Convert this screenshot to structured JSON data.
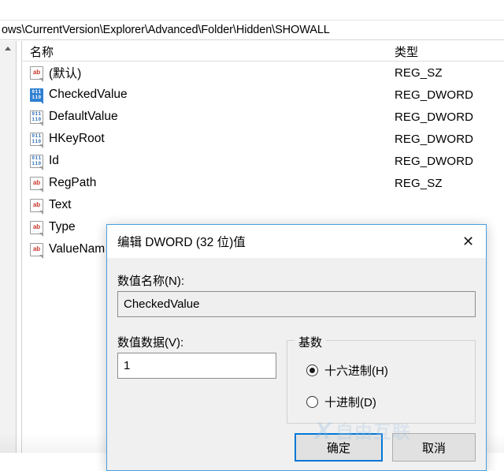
{
  "window": {
    "path_bar_value": "ows\\CurrentVersion\\Explorer\\Advanced\\Folder\\Hidden\\SHOWALL"
  },
  "tree_pane": {
    "scroll_up_icon": "chevron-up-icon"
  },
  "list_view": {
    "columns": [
      "名称",
      "类型"
    ],
    "rows": [
      {
        "name": "(默认)",
        "type": "REG_SZ",
        "icon": "string-value-icon",
        "selected": false
      },
      {
        "name": "CheckedValue",
        "type": "REG_DWORD",
        "icon": "dword-value-icon",
        "selected": true
      },
      {
        "name": "DefaultValue",
        "type": "REG_DWORD",
        "icon": "dword-value-icon",
        "selected": false
      },
      {
        "name": "HKeyRoot",
        "type": "REG_DWORD",
        "icon": "dword-value-icon",
        "selected": false
      },
      {
        "name": "Id",
        "type": "REG_DWORD",
        "icon": "dword-value-icon",
        "selected": false
      },
      {
        "name": "RegPath",
        "type": "REG_SZ",
        "icon": "string-value-icon",
        "selected": false
      },
      {
        "name": "Text",
        "type": "",
        "icon": "string-value-icon",
        "selected": false
      },
      {
        "name": "Type",
        "type": "",
        "icon": "string-value-icon",
        "selected": false
      },
      {
        "name": "ValueNam",
        "type": "",
        "icon": "string-value-icon",
        "selected": false
      }
    ]
  },
  "dialog": {
    "title": "编辑 DWORD (32 位)值",
    "close_icon": "close-icon",
    "name_label": "数值名称(N):",
    "name_value": "CheckedValue",
    "data_label": "数值数据(V):",
    "data_value": "1",
    "radix": {
      "group_label": "基数",
      "options": [
        {
          "label": "十六进制(H)",
          "checked": true
        },
        {
          "label": "十进制(D)",
          "checked": false
        }
      ]
    },
    "ok_label": "确定",
    "cancel_label": "取消"
  },
  "watermark": {
    "mark": "X",
    "text": "自由互联"
  },
  "colors": {
    "accent": "#0078d7",
    "dialog_border": "#4a9fe0",
    "selected_icon": "#2f7fd1",
    "string_icon": "#c8372d",
    "dword_icon": "#2e6fb7"
  }
}
